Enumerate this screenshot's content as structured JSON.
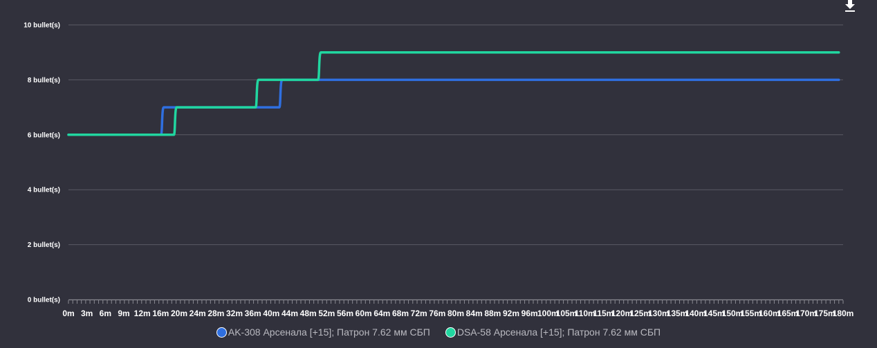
{
  "chart_data": {
    "type": "line",
    "step": true,
    "title": "",
    "xlabel": "",
    "ylabel": "",
    "x_ticks": [
      "0m",
      "3m",
      "6m",
      "9m",
      "12m",
      "16m",
      "20m",
      "24m",
      "28m",
      "32m",
      "36m",
      "40m",
      "44m",
      "48m",
      "52m",
      "56m",
      "60m",
      "64m",
      "68m",
      "72m",
      "76m",
      "80m",
      "84m",
      "88m",
      "92m",
      "96m",
      "100m",
      "105m",
      "110m",
      "115m",
      "120m",
      "125m",
      "130m",
      "135m",
      "140m",
      "145m",
      "150m",
      "155m",
      "160m",
      "165m",
      "170m",
      "175m",
      "180m"
    ],
    "y_ticks": [
      "0 bullet(s)",
      "2 bullet(s)",
      "4 bullet(s)",
      "6 bullet(s)",
      "8 bullet(s)",
      "10 bullet(s)"
    ],
    "ylim": [
      0,
      10
    ],
    "xlim": [
      0,
      180
    ],
    "grid": true,
    "legend_position": "bottom",
    "series": [
      {
        "name": "AK-308 Арсенала [+15]; Патрон 7.62 мм СБП",
        "color": "#2f6fe0",
        "points": [
          [
            0,
            6
          ],
          [
            21.5,
            6
          ],
          [
            21.5,
            7
          ],
          [
            49,
            7
          ],
          [
            49,
            8
          ],
          [
            179,
            8
          ]
        ]
      },
      {
        "name": "DSA-58 Арсенала [+15]; Патрон 7.62 мм СБП",
        "color": "#21d6a0",
        "points": [
          [
            0,
            6
          ],
          [
            24.5,
            6
          ],
          [
            24.5,
            7
          ],
          [
            43.5,
            7
          ],
          [
            43.5,
            8
          ],
          [
            58,
            8
          ],
          [
            58,
            9
          ],
          [
            179,
            9
          ]
        ]
      }
    ]
  },
  "toolbar": {
    "download_icon": "download-icon"
  }
}
